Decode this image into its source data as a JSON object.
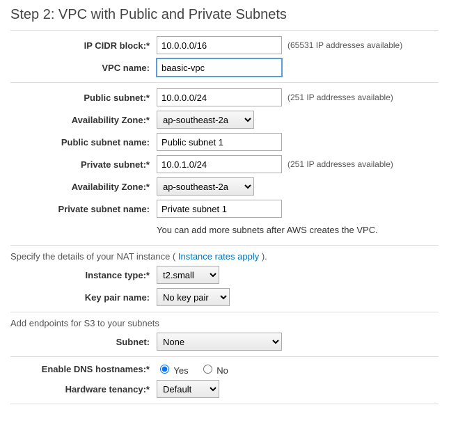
{
  "title": "Step 2: VPC with Public and Private Subnets",
  "cidr": {
    "label": "IP CIDR block:*",
    "value": "10.0.0.0/16",
    "hint": "(65531 IP addresses available)"
  },
  "vpcname": {
    "label": "VPC name:",
    "value": "baasic-vpc"
  },
  "pub_subnet": {
    "label": "Public subnet:*",
    "value": "10.0.0.0/24",
    "hint": "(251 IP addresses available)"
  },
  "pub_az": {
    "label": "Availability Zone:*",
    "value": "ap-southeast-2a"
  },
  "pub_name": {
    "label": "Public subnet name:",
    "value": "Public subnet 1"
  },
  "priv_subnet": {
    "label": "Private subnet:*",
    "value": "10.0.1.0/24",
    "hint": "(251 IP addresses available)"
  },
  "priv_az": {
    "label": "Availability Zone:*",
    "value": "ap-southeast-2a"
  },
  "priv_name": {
    "label": "Private subnet name:",
    "value": "Private subnet 1"
  },
  "subnet_note": "You can add more subnets after AWS creates the VPC.",
  "nat_text_pre": "Specify the details of your NAT instance ( ",
  "nat_link": "Instance rates apply",
  "nat_text_post": " ).",
  "inst_type": {
    "label": "Instance type:*",
    "value": "t2.small"
  },
  "keypair": {
    "label": "Key pair name:",
    "value": "No key pair"
  },
  "s3_text": "Add endpoints for S3 to your subnets",
  "s3_subnet": {
    "label": "Subnet:",
    "value": "None"
  },
  "dns": {
    "label": "Enable DNS hostnames:*",
    "yes": "Yes",
    "no": "No"
  },
  "tenancy": {
    "label": "Hardware tenancy:*",
    "value": "Default"
  }
}
